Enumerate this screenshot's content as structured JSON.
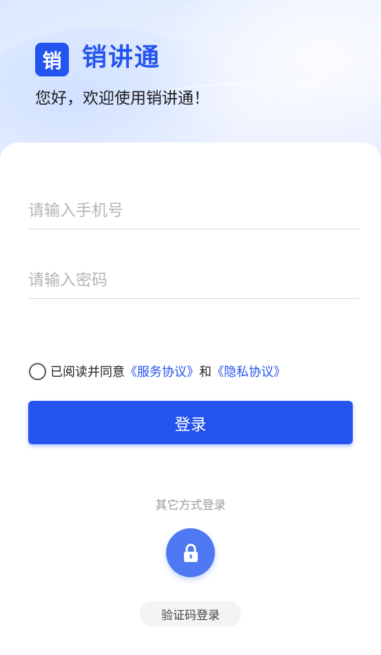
{
  "header": {
    "logo_char": "销",
    "app_name": "销讲通",
    "welcome": "您好，欢迎使用销讲通！"
  },
  "form": {
    "phone_placeholder": "请输入手机号",
    "password_placeholder": "请输入密码"
  },
  "agreement": {
    "prefix": "已阅读并同意",
    "service_link": "《服务协议》",
    "and": "和",
    "privacy_link": "《隐私协议》",
    "checked": false
  },
  "login_button": "登录",
  "other_methods": {
    "label": "其它方式登录",
    "lock_icon": "lock-icon",
    "sms_login": "验证码登录"
  },
  "colors": {
    "accent": "#2454f0",
    "lock_button": "#4f79f2"
  }
}
